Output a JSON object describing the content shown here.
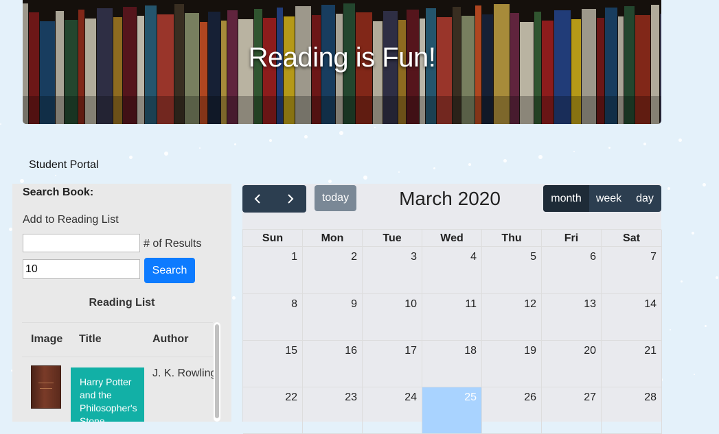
{
  "banner": {
    "title": "Reading is Fun!"
  },
  "nav": {
    "portal_label": "Student Portal"
  },
  "search": {
    "heading": "Search Book:",
    "add_label": "Add to Reading List",
    "query_value": "",
    "results_label": "# of Results",
    "count_value": "10",
    "button_label": "Search"
  },
  "reading_list": {
    "title": "Reading List",
    "columns": [
      "Image",
      "Title",
      "Author"
    ],
    "rows": [
      {
        "title": "Harry Potter and the Philosopher's Stone",
        "author": "J. K. Rowling"
      }
    ]
  },
  "calendar": {
    "title": "March 2020",
    "today_label": "today",
    "prev_icon": "chevron-left-icon",
    "next_icon": "chevron-right-icon",
    "views": [
      "month",
      "week",
      "day"
    ],
    "active_view": "month",
    "days_of_week": [
      "Sun",
      "Mon",
      "Tue",
      "Wed",
      "Thu",
      "Fri",
      "Sat"
    ],
    "weeks": [
      [
        "1",
        "2",
        "3",
        "4",
        "5",
        "6",
        "7"
      ],
      [
        "8",
        "9",
        "10",
        "11",
        "12",
        "13",
        "14"
      ],
      [
        "15",
        "16",
        "17",
        "18",
        "19",
        "20",
        "21"
      ],
      [
        "22",
        "23",
        "24",
        "25",
        "26",
        "27",
        "28"
      ]
    ],
    "highlighted_day": "25",
    "highlight_color": "#a9d3ff"
  },
  "colors": {
    "primary_button": "#0d7bff",
    "calendar_buttons": "#2c3e50",
    "reading_chip": "#12b0a6"
  }
}
